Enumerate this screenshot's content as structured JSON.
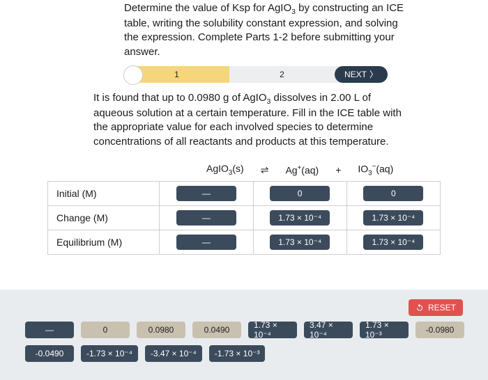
{
  "prompt1_html": "Determine the value of Ksp for AgIO<sub>3</sub> by constructing an ICE table, writing the solubility constant expression, and solving the expression. Complete Parts 1-2 before submitting your answer.",
  "stepper": {
    "step1": "1",
    "step2": "2",
    "next": "NEXT"
  },
  "prompt2_html": "It is found that up to 0.0980 g of AgIO<sub>3</sub> dissolves in 2.00 L of aqueous solution at a certain temperature. Fill in the ICE table with the appropriate value for each involved species to determine concentrations of all reactants and products at this temperature.",
  "ice": {
    "species": {
      "a_html": "AgIO<sub>3</sub>(s)",
      "eq": "⇌",
      "b_html": "Ag<sup>+</sup>(aq)",
      "plus": "+",
      "c_html": "IO<sub>3</sub><sup>−</sup>(aq)"
    },
    "rows": [
      {
        "label": "Initial (M)",
        "a": "—",
        "b": "0",
        "c": "0"
      },
      {
        "label": "Change (M)",
        "a": "—",
        "b": "1.73 × 10⁻⁴",
        "c": "1.73 × 10⁻⁴"
      },
      {
        "label": "Equilibrium (M)",
        "a": "—",
        "b": "1.73 × 10⁻⁴",
        "c": "1.73 × 10⁻⁴"
      }
    ]
  },
  "bank": {
    "reset": "RESET",
    "row1": [
      "—",
      "0",
      "0.0980",
      "0.0490",
      "1.73 × 10⁻⁴",
      "3.47 × 10⁻⁴",
      "1.73 × 10⁻³",
      "-0.0980"
    ],
    "row2": [
      "-0.0490",
      "-1.73 × 10⁻⁴",
      "-3.47 × 10⁻⁴",
      "-1.73 × 10⁻³"
    ]
  }
}
